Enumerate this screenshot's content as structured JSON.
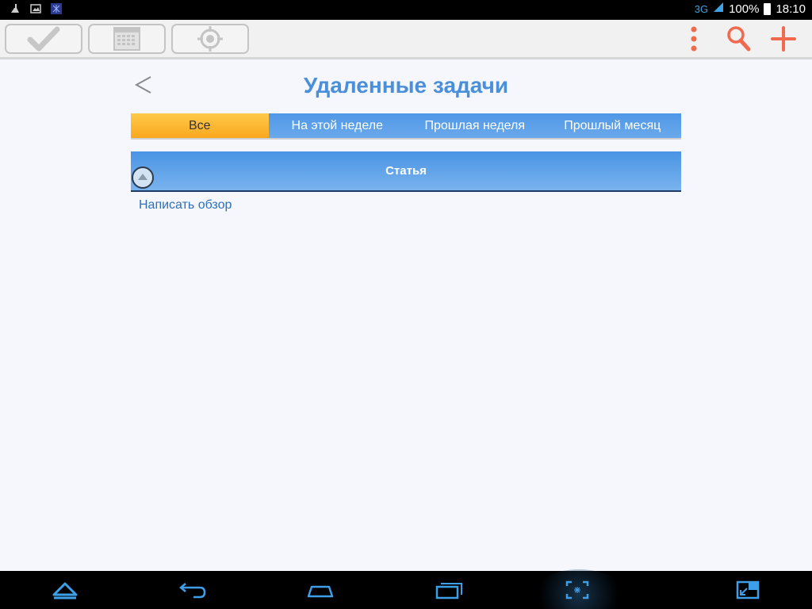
{
  "status_bar": {
    "network": "3G",
    "battery": "100%",
    "time": "18:10",
    "left_icons": [
      "cleaner-icon",
      "image-icon",
      "app-notification-icon"
    ]
  },
  "toolbar": {
    "left_buttons": [
      "checkmark-icon",
      "calendar-icon",
      "target-icon"
    ],
    "right_buttons": [
      "overflow-menu-icon",
      "search-icon",
      "add-icon"
    ]
  },
  "page": {
    "title": "Удаленные задачи",
    "back_icon": "chevron-left-icon"
  },
  "tabs": [
    {
      "label": "Все",
      "active": true
    },
    {
      "label": "На этой неделе",
      "active": false
    },
    {
      "label": "Прошлая неделя",
      "active": false
    },
    {
      "label": "Прошлый месяц",
      "active": false
    }
  ],
  "group": {
    "title": "Статья",
    "items": [
      "Написать обзор"
    ]
  },
  "nav_bar": {
    "icons": [
      "home-up-icon",
      "back-icon",
      "home-icon",
      "recents-icon",
      "screenshot-icon",
      "window-icon"
    ]
  },
  "colors": {
    "accent_blue": "#4a8fd9",
    "active_tab": "#f9a81e",
    "link": "#2e6fb8",
    "toolbar_icon_red": "#ef6a4f"
  }
}
